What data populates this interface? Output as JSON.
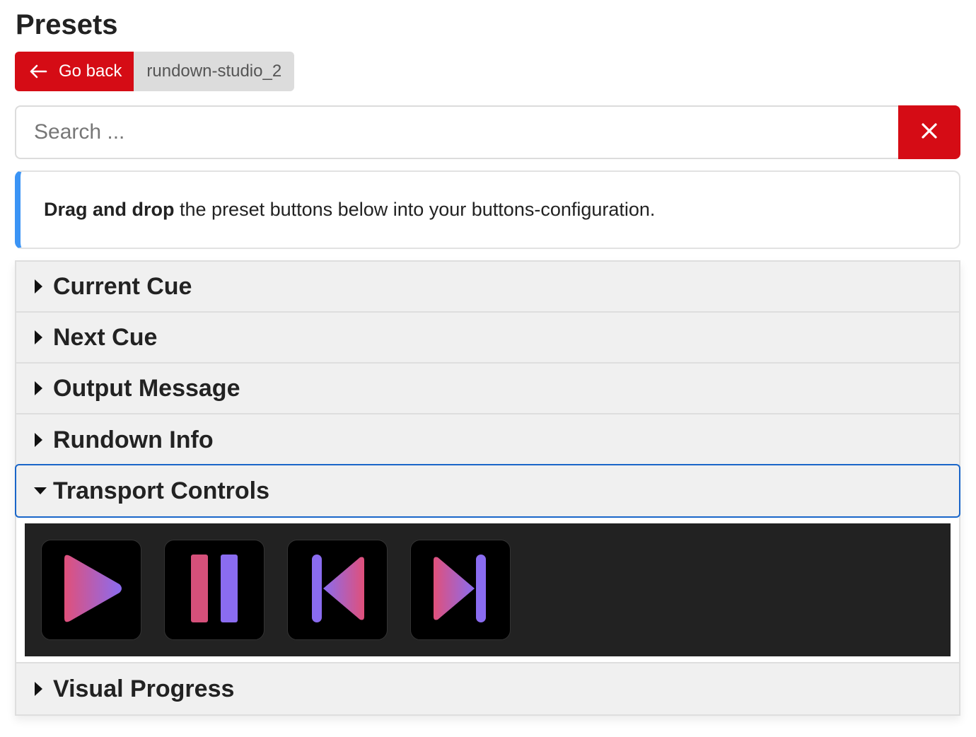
{
  "page": {
    "title": "Presets"
  },
  "toolbar": {
    "go_back_label": "Go back",
    "connection_label": "rundown-studio_2"
  },
  "search": {
    "placeholder": "Search ...",
    "value": ""
  },
  "callout": {
    "bold_text": "Drag and drop",
    "rest_text": " the preset buttons below into your buttons-configuration.",
    "accent_color": "#3b94f5"
  },
  "accordion": {
    "sections": [
      {
        "label": "Current Cue",
        "expanded": false
      },
      {
        "label": "Next Cue",
        "expanded": false
      },
      {
        "label": "Output Message",
        "expanded": false
      },
      {
        "label": "Rundown Info",
        "expanded": false
      },
      {
        "label": "Transport Controls",
        "expanded": true
      },
      {
        "label": "Visual Progress",
        "expanded": false
      }
    ]
  },
  "transport_presets": [
    {
      "icon": "play-icon"
    },
    {
      "icon": "pause-icon"
    },
    {
      "icon": "skip-previous-icon"
    },
    {
      "icon": "skip-next-icon"
    }
  ],
  "colors": {
    "brand_red": "#d50c15",
    "focus_blue": "#1a66c9",
    "gradient_pink": "#e0507a",
    "gradient_purple": "#8a6cf0"
  }
}
